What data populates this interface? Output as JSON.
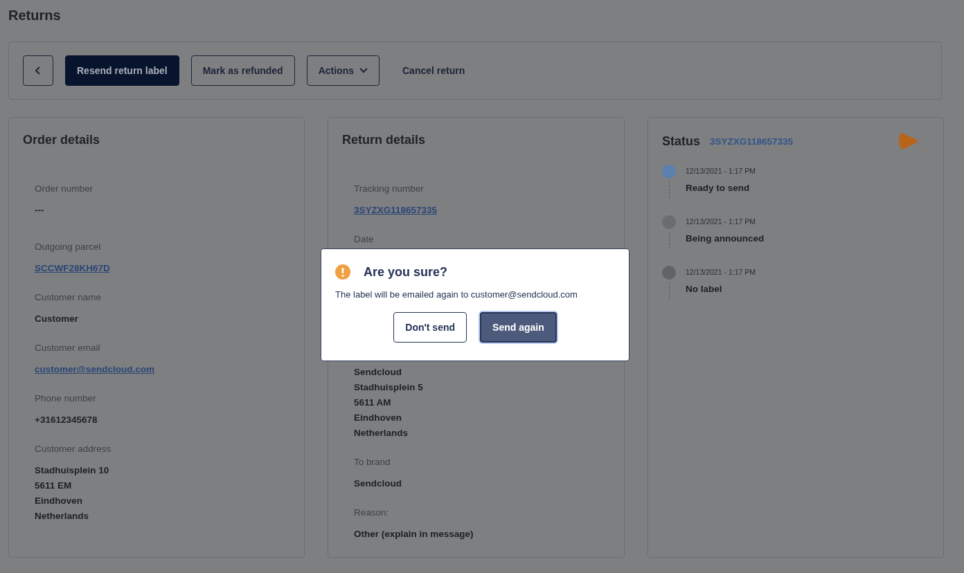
{
  "page": {
    "title": "Returns"
  },
  "toolbar": {
    "buttons": [
      {
        "label": "Resend return label",
        "kind": "primary"
      },
      {
        "label": "Mark as refunded",
        "kind": "outline"
      },
      {
        "label": "Actions",
        "kind": "dropdown"
      },
      {
        "label": "Cancel return",
        "kind": "text"
      }
    ]
  },
  "order_details": {
    "title": "Order details",
    "fields": [
      {
        "kind": "text",
        "label": "Order number",
        "value": "---"
      },
      {
        "kind": "link",
        "label": "Outgoing parcel",
        "value": "SCCWF28KH67D"
      },
      {
        "kind": "text",
        "label": "Customer name",
        "value": "Customer"
      },
      {
        "kind": "link",
        "label": "Customer email",
        "value": "customer@sendcloud.com"
      },
      {
        "kind": "text",
        "label": "Phone number",
        "value": "+31612345678"
      },
      {
        "kind": "lines",
        "label": "Customer address",
        "lines": [
          "Stadhuisplein 10",
          "5611 EM",
          "Eindhoven",
          "Netherlands"
        ]
      }
    ]
  },
  "return_details": {
    "title": "Return details",
    "fields": [
      {
        "kind": "link",
        "label": "Tracking number",
        "value": "3SYZXG118657335"
      },
      {
        "kind": "label-only",
        "label": "Date"
      },
      {
        "kind": "lines",
        "lines": [
          "Sendcloud",
          "Stadhuisplein 5",
          "5611 AM",
          "Eindhoven",
          "Netherlands"
        ]
      },
      {
        "kind": "text",
        "label": "To brand",
        "value": "Sendcloud"
      },
      {
        "kind": "text",
        "label": "Reason:",
        "value": "Other (explain in message)"
      }
    ]
  },
  "status": {
    "title": "Status",
    "tracking": "3SYZXG118657335",
    "events": [
      {
        "time": "12/13/2021 - 1:17 PM",
        "title": "Ready to send",
        "color": "#5b7fae"
      },
      {
        "time": "12/13/2021 - 1:17 PM",
        "title": "Being announced",
        "color": "#6c6d70"
      },
      {
        "time": "12/13/2021 - 1:17 PM",
        "title": "No label",
        "color": "#626366"
      }
    ]
  },
  "dialog": {
    "title": "Are you sure?",
    "message": "The label will be emailed again to customer@sendcloud.com",
    "buttons": [
      {
        "label": "Don't send",
        "kind": "outline"
      },
      {
        "label": "Send again",
        "kind": "primary"
      }
    ]
  }
}
